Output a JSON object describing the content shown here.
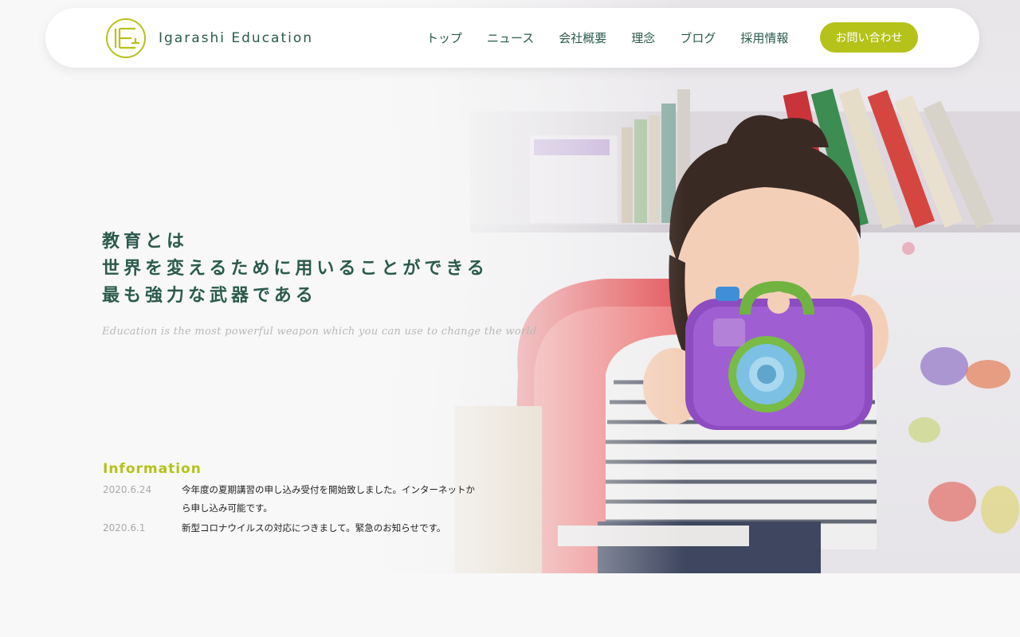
{
  "header": {
    "logo_text": "Igarashi Education",
    "nav": [
      "トップ",
      "ニュース",
      "会社概要",
      "理念",
      "ブログ",
      "採用情報"
    ],
    "contact_label": "お問い合わせ"
  },
  "hero": {
    "catch_lines": [
      "教育とは",
      "世界を変えるために用いることができる",
      "最も強力な武器である"
    ],
    "subcopy": "Education is the most powerful weapon which you can use to change the world"
  },
  "information": {
    "title": "Information",
    "items": [
      {
        "date": "2020.6.24",
        "text": "今年度の夏期講習の申し込み受付を開始致しました。インターネットから申し込み可能です。"
      },
      {
        "date": "2020.6.1",
        "text": "新型コロナウイルスの対応につきまして。緊急のお知らせです。"
      }
    ]
  },
  "colors": {
    "brand_green": "#2b5a4c",
    "accent_lime": "#b5c21a",
    "background": "#f8f8f8"
  },
  "icons": {
    "logo": "logo-mark-icon"
  }
}
